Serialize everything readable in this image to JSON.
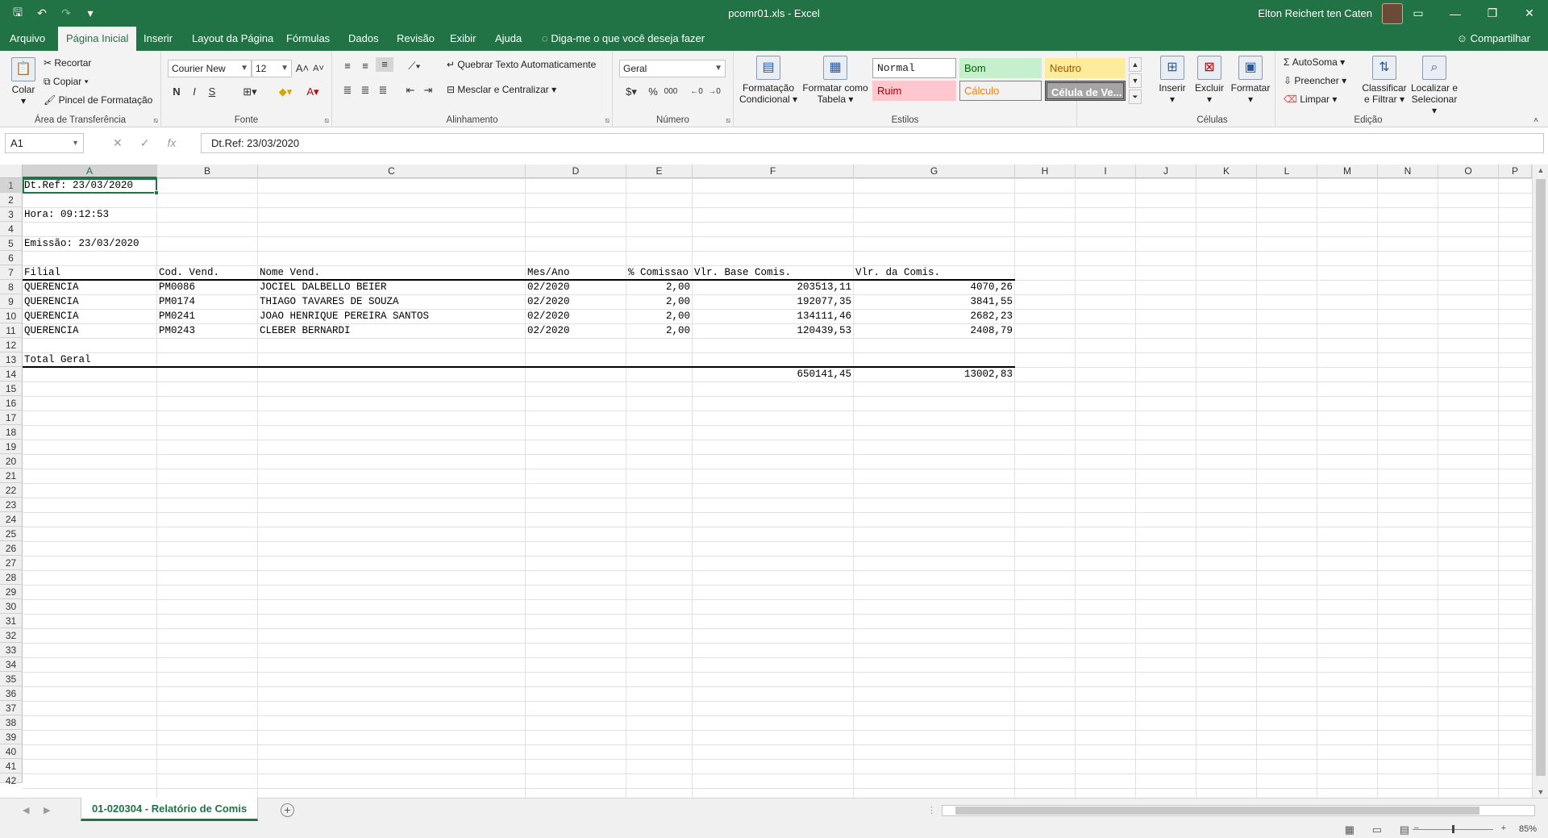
{
  "window": {
    "title": "pcomr01.xls - Excel",
    "user_name": "Elton Reichert ten Caten",
    "controls": {
      "ribbon_display": "▭",
      "minimize": "—",
      "restore": "❐",
      "close": "✕"
    }
  },
  "quick_access": {
    "save": "🖫",
    "undo": "↶",
    "redo": "↷",
    "customize": "▾"
  },
  "tabs": [
    "Arquivo",
    "Página Inicial",
    "Inserir",
    "Layout da Página",
    "Fórmulas",
    "Dados",
    "Revisão",
    "Exibir",
    "Ajuda"
  ],
  "active_tab": "Página Inicial",
  "tell_me": "Diga-me o que você deseja fazer",
  "share": "Compartilhar",
  "ribbon": {
    "clipboard": {
      "paste": "Colar",
      "cut": "Recortar",
      "copy": "Copiar",
      "format_painter": "Pincel de Formatação",
      "label": "Área de Transferência"
    },
    "font": {
      "name": "Courier New",
      "size": "12",
      "bold": "N",
      "italic": "I",
      "underline": "S",
      "label": "Fonte"
    },
    "alignment": {
      "wrap": "Quebrar Texto Automaticamente",
      "merge": "Mesclar e Centralizar",
      "label": "Alinhamento"
    },
    "number": {
      "format": "Geral",
      "percent": "%",
      "thousands": "000",
      "label": "Número"
    },
    "styles": {
      "conditional": [
        "Formatação",
        "Condicional"
      ],
      "as_table": [
        "Formatar como",
        "Tabela"
      ],
      "normal": "Normal",
      "good": "Bom",
      "neutral": "Neutro",
      "bad": "Ruim",
      "calc": "Cálculo",
      "check": "Célula de Ve...",
      "label": "Estilos"
    },
    "cells": {
      "insert": "Inserir",
      "delete": "Excluir",
      "format": "Formatar",
      "label": "Células"
    },
    "editing": {
      "autosum": "AutoSoma",
      "fill": "Preencher",
      "clear": "Limpar",
      "sort": [
        "Classificar",
        "e Filtrar"
      ],
      "find": [
        "Localizar e",
        "Selecionar"
      ],
      "label": "Edição"
    }
  },
  "formula_bar": {
    "name_box": "A1",
    "formula": "Dt.Ref: 23/03/2020",
    "cancel": "✕",
    "enter": "✓",
    "fx": "fx"
  },
  "columns": [
    "A",
    "B",
    "C",
    "D",
    "E",
    "F",
    "G",
    "H",
    "I",
    "J",
    "K",
    "L",
    "M",
    "N",
    "O",
    "P"
  ],
  "rows": [
    "1",
    "2",
    "3",
    "4",
    "5",
    "6",
    "7",
    "8",
    "9",
    "10",
    "11",
    "12",
    "13",
    "14",
    "15",
    "16",
    "17",
    "18",
    "19",
    "20",
    "21",
    "22",
    "23",
    "24",
    "25",
    "26",
    "27",
    "28",
    "29",
    "30",
    "31",
    "32",
    "33",
    "34",
    "35",
    "36",
    "37",
    "38",
    "39",
    "40",
    "41",
    "42"
  ],
  "report": {
    "ref_date": "Dt.Ref: 23/03/2020",
    "time": "Hora: 09:12:53",
    "emission": "Emissão: 23/03/2020",
    "headers": [
      "Filial",
      "Cod. Vend.",
      "Nome Vend.",
      "Mes/Ano",
      "% Comissao",
      "Vlr. Base Comis.",
      "Vlr. da Comis."
    ],
    "rows": [
      [
        "QUERENCIA",
        "PM0086",
        "JOCIEL DALBELLO BEIER",
        "02/2020",
        "2,00",
        "203513,11",
        "4070,26"
      ],
      [
        "QUERENCIA",
        "PM0174",
        "THIAGO TAVARES DE SOUZA",
        "02/2020",
        "2,00",
        "192077,35",
        "3841,55"
      ],
      [
        "QUERENCIA",
        "PM0241",
        "JOAO HENRIQUE PEREIRA SANTOS",
        "02/2020",
        "2,00",
        "134111,46",
        "2682,23"
      ],
      [
        "QUERENCIA",
        "PM0243",
        "CLEBER BERNARDI",
        "02/2020",
        "2,00",
        "120439,53",
        "2408,79"
      ]
    ],
    "total_label": "Total Geral",
    "total_base": "650141,45",
    "total_comis": "13002,83"
  },
  "sheet_tab": "01-020304 - Relatório de Comis",
  "add_sheet": "+",
  "zoom": "85%"
}
